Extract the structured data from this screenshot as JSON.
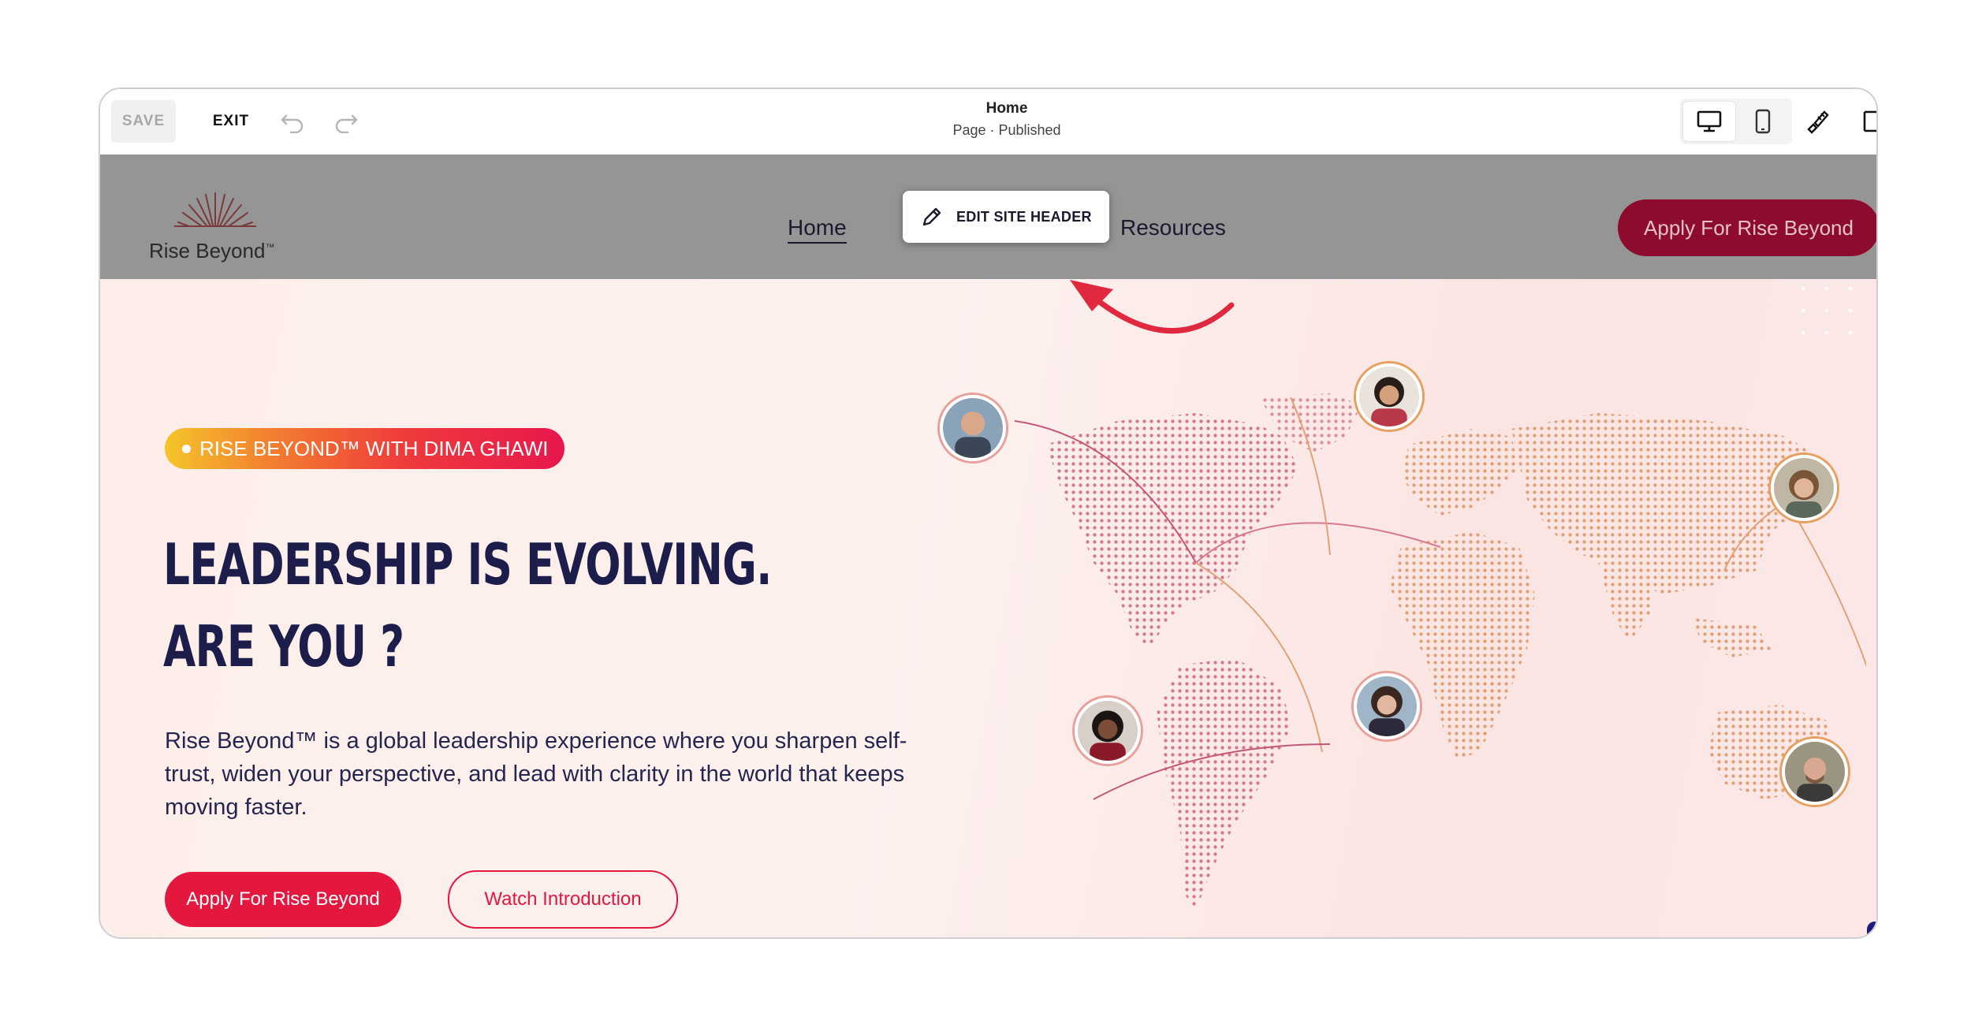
{
  "editor": {
    "save_label": "SAVE",
    "exit_label": "EXIT",
    "page_title": "Home",
    "page_status": "Page · Published"
  },
  "site_header": {
    "logo_text": "Rise Beyond",
    "logo_tm": "™",
    "nav": {
      "home": "Home",
      "resources": "Resources"
    },
    "edit_header_label": "EDIT SITE HEADER",
    "apply_label": "Apply For Rise Beyond"
  },
  "hero": {
    "badge": "RISE BEYOND™ WITH DIMA GHAWI",
    "headline_line1": "LEADERSHIP IS EVOLVING.",
    "headline_line2": "ARE YOU ?",
    "paragraph": "Rise Beyond™ is a global leadership experience where you sharpen self-trust, widen your  perspective, and lead with clarity in the world that keeps moving faster.",
    "apply_label": "Apply For Rise Beyond",
    "watch_label": "Watch Introduction"
  },
  "colors": {
    "brand_red": "#e4173f",
    "header_apply_bg": "#8d0b2c",
    "navy": "#1c1d4a",
    "header_bg": "#959595"
  },
  "icons": [
    "undo-icon",
    "redo-icon",
    "desktop-icon",
    "mobile-icon",
    "brush-icon",
    "panel-icon",
    "pencil-icon",
    "arrow-annotation-icon",
    "world-map",
    "sunburst-logo-icon"
  ]
}
